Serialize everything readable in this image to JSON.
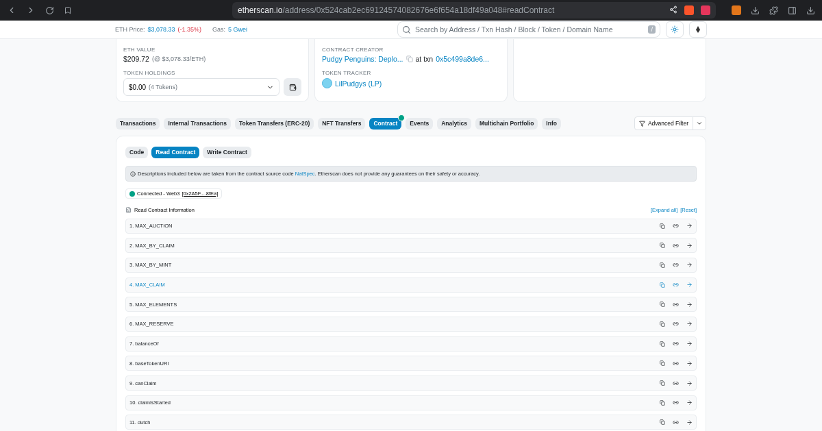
{
  "browser": {
    "url_host": "etherscan.io",
    "url_path": "/address/0x524cab2ec69124574082676e6f654a18df49a048#readContract"
  },
  "header": {
    "eth_price_label": "ETH Price:",
    "eth_price": "$3,078.33",
    "eth_change": "(-1.35%)",
    "gas_label": "Gas:",
    "gas": "5 Gwei",
    "search": {
      "placeholder": "Search by Address / Txn Hash / Block / Token / Domain Name"
    },
    "search_key": "/"
  },
  "overview": {
    "eth_value_label": "ETH VALUE",
    "eth_value": "$209.72",
    "eth_value_rate": "(@ $3,078.33/ETH)",
    "token_holdings_label": "TOKEN HOLDINGS",
    "token_holdings": "$0.00",
    "token_count": "(4 Tokens)"
  },
  "more_info": {
    "creator_label": "CONTRACT CREATOR",
    "creator": "Pudgy Penguins: Deplo...",
    "at_txn": "at txn",
    "txn": "0x5c499a8de6...",
    "tracker_label": "TOKEN TRACKER",
    "tracker": "LilPudgys (LP)"
  },
  "tabs": [
    {
      "label": "Transactions",
      "selected": false,
      "verified": false
    },
    {
      "label": "Internal Transactions",
      "selected": false,
      "verified": false
    },
    {
      "label": "Token Transfers (ERC-20)",
      "selected": false,
      "verified": false
    },
    {
      "label": "NFT Transfers",
      "selected": false,
      "verified": false
    },
    {
      "label": "Contract",
      "selected": true,
      "verified": true
    },
    {
      "label": "Events",
      "selected": false,
      "verified": false
    },
    {
      "label": "Analytics",
      "selected": false,
      "verified": false
    },
    {
      "label": "Multichain Portfolio",
      "selected": false,
      "verified": false
    },
    {
      "label": "Info",
      "selected": false,
      "verified": false
    }
  ],
  "advanced_filter": "Advanced Filter",
  "subtabs": [
    {
      "label": "Code",
      "selected": false
    },
    {
      "label": "Read Contract",
      "selected": true
    },
    {
      "label": "Write Contract",
      "selected": false
    }
  ],
  "notice": {
    "before": "Descriptions included below are taken from the contract source code",
    "link": "NatSpec",
    "after": ". Etherscan does not provide any guarantees on their safety or accuracy."
  },
  "connection": {
    "connected": true,
    "label": "Connected - Web3",
    "address": "[0x2A5F....8fEa]"
  },
  "read_info": "Read Contract Information",
  "expand_all": "[Expand all]",
  "reset": "[Reset]",
  "functions": [
    {
      "label": "1. MAX_AUCTION",
      "hovered": false
    },
    {
      "label": "2. MAX_BY_CLAIM",
      "hovered": false
    },
    {
      "label": "3. MAX_BY_MINT",
      "hovered": false
    },
    {
      "label": "4. MAX_CLAIM",
      "hovered": true
    },
    {
      "label": "5. MAX_ELEMENTS",
      "hovered": false
    },
    {
      "label": "6. MAX_RESERVE",
      "hovered": false
    },
    {
      "label": "7. balanceOf",
      "hovered": false
    },
    {
      "label": "8. baseTokenURI",
      "hovered": false
    },
    {
      "label": "9. canClaim",
      "hovered": false
    },
    {
      "label": "10. claimIsStarted",
      "hovered": false
    },
    {
      "label": "11. dutch",
      "hovered": false
    }
  ]
}
